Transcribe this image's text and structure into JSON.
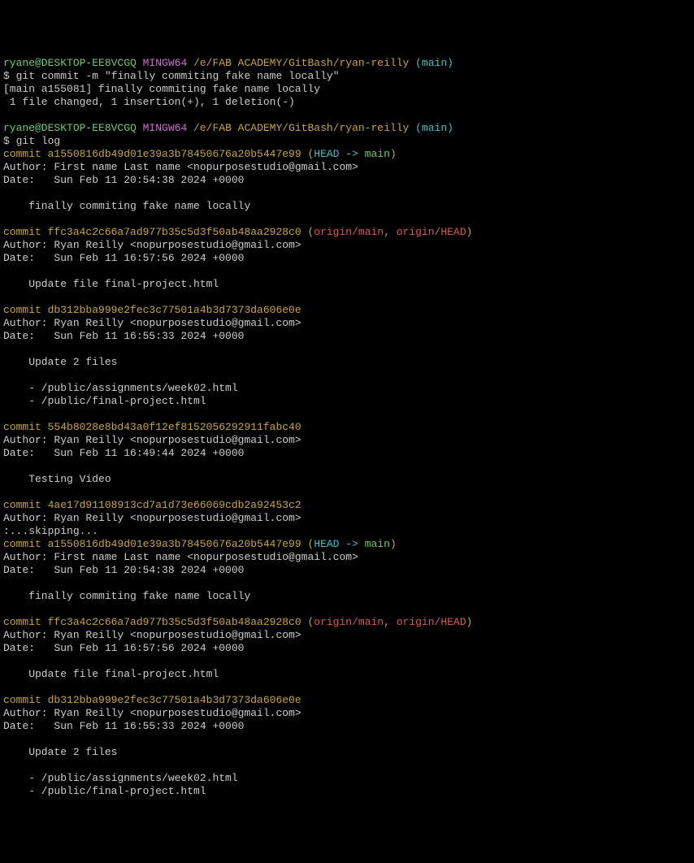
{
  "prompt": {
    "user": "ryane@DESKTOP-EE8VCGQ",
    "host_tag": "MINGW64",
    "path": "/e/FAB ACADEMY/GitBash/ryan-reilly",
    "branch": "(main)",
    "dollar": "$"
  },
  "cmd1": "git commit -m \"finally commiting fake name locally\"",
  "cmd1_out1": "[main a155081] finally commiting fake name locally",
  "cmd1_out2": " 1 file changed, 1 insertion(+), 1 deletion(-)",
  "cmd2": "git log",
  "commits": {
    "c1": {
      "prefix": "commit ",
      "hash": "a1550816db49d01e39a3b78450676a20b5447e99",
      "open": " (",
      "head": "HEAD -> ",
      "main": "main",
      "close": ")",
      "author": "Author: First name Last name <nopurposestudio@gmail.com>",
      "date": "Date:   Sun Feb 11 20:54:38 2024 +0000",
      "msg": "    finally commiting fake name locally"
    },
    "c2": {
      "prefix": "commit ",
      "hash": "ffc3a4c2c66a7ad977b35c5d3f50ab48aa2928c0",
      "open": " (",
      "ref1": "origin/main",
      "comma": ", ",
      "ref2": "origin/HEAD",
      "close": ")",
      "author": "Author: Ryan Reilly <nopurposestudio@gmail.com>",
      "date": "Date:   Sun Feb 11 16:57:56 2024 +0000",
      "msg": "    Update file final-project.html"
    },
    "c3": {
      "prefix": "commit ",
      "hash": "db312bba999e2fec3c77501a4b3d7373da606e0e",
      "author": "Author: Ryan Reilly <nopurposestudio@gmail.com>",
      "date": "Date:   Sun Feb 11 16:55:33 2024 +0000",
      "msg": "    Update 2 files",
      "msg2": "    - /public/assignments/week02.html",
      "msg3": "    - /public/final-project.html"
    },
    "c4": {
      "prefix": "commit ",
      "hash": "554b8028e8bd43a0f12ef8152056292911fabc40",
      "author": "Author: Ryan Reilly <nopurposestudio@gmail.com>",
      "date": "Date:   Sun Feb 11 16:49:44 2024 +0000",
      "msg": "    Testing Video"
    },
    "c5": {
      "prefix": "commit ",
      "hash": "4ae17d91108913cd7a1d73e66069cdb2a92453c2",
      "author": "Author: Ryan Reilly <nopurposestudio@gmail.com>"
    }
  },
  "skipping": ":...skipping..."
}
